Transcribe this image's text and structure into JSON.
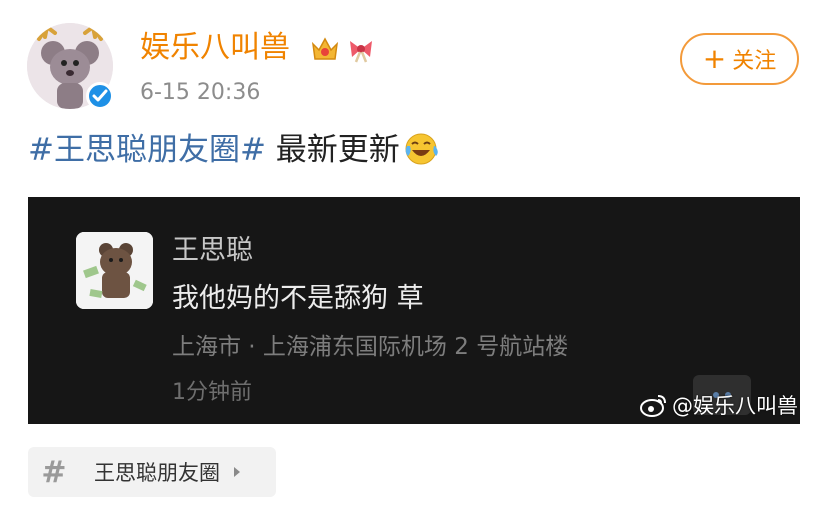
{
  "post": {
    "author": "娱乐八叫兽",
    "timestamp": "6-15 20:36",
    "follow_label": "关注",
    "follow_plus": "+",
    "hashtag": "#王思聪朋友圈#",
    "text": " 最新更新",
    "emoji": "laughing-crying-emoji"
  },
  "screenshot": {
    "name": "王思聪",
    "message": "我他妈的不是舔狗 草",
    "location": "上海市 · 上海浦东国际机场 2 号航站楼",
    "time": "1分钟前",
    "watermark": "@娱乐八叫兽"
  },
  "topic": {
    "hash": "#",
    "label": "王思聪朋友圈"
  },
  "colors": {
    "username": "#f08300",
    "hashtag": "#3f6ea6",
    "verified": "#1e90e6",
    "panel": "#161616"
  }
}
